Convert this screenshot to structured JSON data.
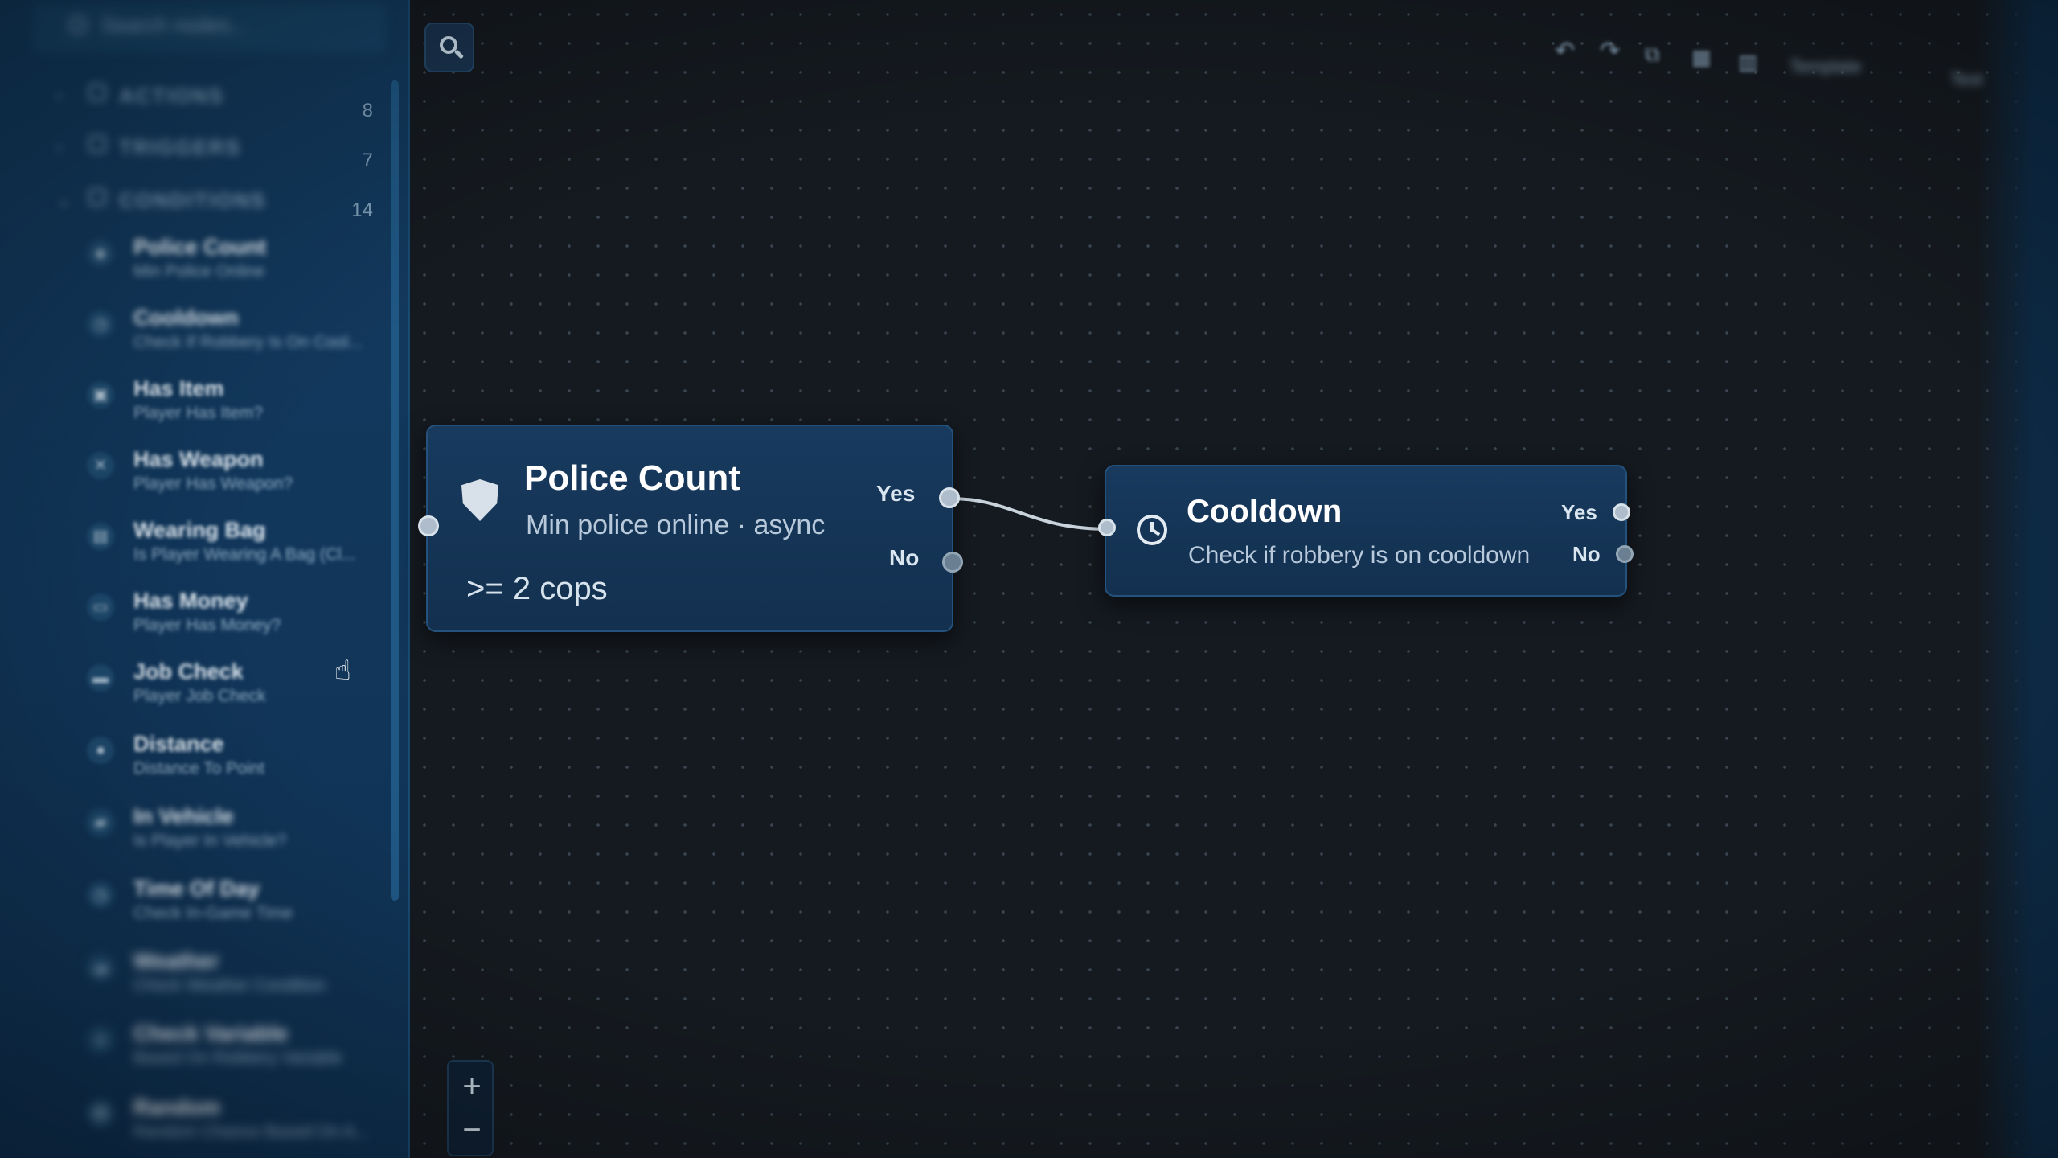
{
  "sidebar": {
    "search_placeholder": "Search nodes...",
    "categories": [
      {
        "label": "ACTIONS",
        "count": "8"
      },
      {
        "label": "TRIGGERS",
        "count": "7"
      },
      {
        "label": "CONDITIONS",
        "count": "14"
      }
    ],
    "conditions": [
      {
        "title": "Police Count",
        "subtitle": "Min Police Online",
        "icon": "shield-icon"
      },
      {
        "title": "Cooldown",
        "subtitle": "Check If Robbery Is On Cool...",
        "icon": "clock-icon"
      },
      {
        "title": "Has Item",
        "subtitle": "Player Has Item?",
        "icon": "box-icon"
      },
      {
        "title": "Has Weapon",
        "subtitle": "Player Has Weapon?",
        "icon": "crossed-swords-icon"
      },
      {
        "title": "Wearing Bag",
        "subtitle": "Is Player Wearing A Bag (Cl...",
        "icon": "bag-icon"
      },
      {
        "title": "Has Money",
        "subtitle": "Player Has Money?",
        "icon": "wallet-icon"
      },
      {
        "title": "Job Check",
        "subtitle": "Player Job Check",
        "icon": "briefcase-icon"
      },
      {
        "title": "Distance",
        "subtitle": "Distance To Point",
        "icon": "map-pin-icon"
      },
      {
        "title": "In Vehicle",
        "subtitle": "Is Player In Vehicle?",
        "icon": "car-icon"
      },
      {
        "title": "Time Of Day",
        "subtitle": "Check In-Game Time",
        "icon": "clock-icon"
      },
      {
        "title": "Weather",
        "subtitle": "Check Weather Condition",
        "icon": "cloud-icon"
      },
      {
        "title": "Check Variable",
        "subtitle": "Based On Robbery Variable",
        "icon": "variable-icon"
      },
      {
        "title": "Random",
        "subtitle": "Random Chance Based On A...",
        "icon": "dice-icon"
      }
    ]
  },
  "toolbar": {
    "buttons": [
      "undo",
      "redo",
      "copy",
      "save",
      "grid"
    ],
    "template_label": "Template",
    "extra_label": "Test"
  },
  "zoom": {
    "plus": "+",
    "minus": "−"
  },
  "nodes": {
    "police": {
      "title": "Police Count",
      "description": "Min police online · async",
      "value": ">= 2 cops",
      "out_yes": "Yes",
      "out_no": "No"
    },
    "cooldown": {
      "title": "Cooldown",
      "description": "Check if robbery is on cooldown",
      "out_yes": "Yes",
      "out_no": "No"
    }
  },
  "colors": {
    "sidebar_bg": "#123a5e",
    "canvas_bg": "#151a20",
    "node_bg": "#173a5e",
    "node_border": "#24527c",
    "port": "#aebccb",
    "wire": "#c9d3dc"
  }
}
